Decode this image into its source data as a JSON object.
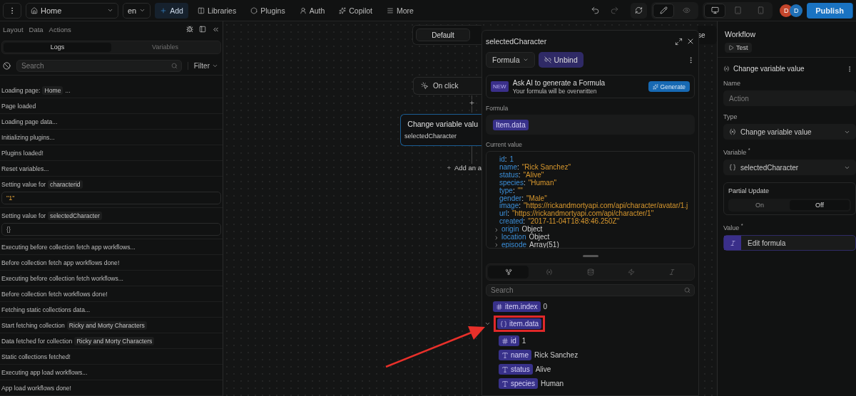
{
  "topbar": {
    "page": "Home",
    "lang": "en",
    "nav": [
      {
        "kind": "add",
        "label": "Add"
      },
      {
        "kind": "libraries",
        "label": "Libraries"
      },
      {
        "kind": "plugins",
        "label": "Plugins"
      },
      {
        "kind": "auth",
        "label": "Auth"
      },
      {
        "kind": "copilot",
        "label": "Copilot"
      },
      {
        "kind": "more",
        "label": "More"
      }
    ],
    "modes": [
      {
        "kind": "edit",
        "selected": true
      },
      {
        "kind": "preview",
        "selected": false
      }
    ],
    "devices": [
      {
        "kind": "desktop",
        "selected": true
      },
      {
        "kind": "tablet",
        "selected": false
      },
      {
        "kind": "mobile",
        "selected": false
      }
    ],
    "avatars": [
      {
        "letter": "D",
        "color": "#c4452b"
      },
      {
        "letter": "D",
        "color": "#1f6fb5"
      }
    ],
    "publish": "Publish"
  },
  "left_panel": {
    "tabs": [
      "Layout",
      "Data",
      "Actions"
    ],
    "segments": [
      {
        "label": "Logs",
        "selected": true
      },
      {
        "label": "Variables",
        "selected": false
      }
    ],
    "search": {
      "placeholder": "Search"
    },
    "filter": "Filter",
    "logs": [
      {
        "text": "Loading page:",
        "tag": "Home",
        "after": "..."
      },
      {
        "text": "Page loaded"
      },
      {
        "text": "Loading page data..."
      },
      {
        "text": "Initializing plugins..."
      },
      {
        "text": "Plugins loaded!"
      },
      {
        "text": "Reset variables..."
      },
      {
        "text": "Setting value for",
        "tag": "characterid",
        "value": "\"1\"",
        "kind": "string"
      },
      {
        "text": "Setting value for",
        "tag": "selectedCharacter",
        "value": "{}",
        "kind": "object"
      },
      {
        "text": "Executing before collection fetch app workflows..."
      },
      {
        "text": "Before collection fetch app workflows done!"
      },
      {
        "text": "Executing before collection fetch workflows..."
      },
      {
        "text": "Before collection fetch workflows done!"
      },
      {
        "text": "Fetching static collections data..."
      },
      {
        "text": "Start fetching collection",
        "tag": "Ricky and Morty Characters"
      },
      {
        "text": "Data fetched for collection",
        "tag": "Ricky and Morty Characters"
      },
      {
        "text": "Static collections fetched!"
      },
      {
        "text": "Executing app load workflows..."
      },
      {
        "text": "App load workflows done!"
      }
    ]
  },
  "canvas": {
    "state_tab": "Default",
    "corner_button": "se",
    "trigger": "On click",
    "action": {
      "title": "Change variable valu",
      "subtitle": "selectedCharacter"
    },
    "add_action": "Add an a"
  },
  "formula_popup": {
    "title": "selectedCharacter",
    "mode": "Formula",
    "unbind": "Unbind",
    "ai": {
      "badge": "NEW",
      "title": "Ask AI to generate a Formula",
      "subtitle": "Your formula will be overwritten",
      "button": "Generate"
    },
    "formula_label": "Formula",
    "formula": "Item.data",
    "current_label": "Current value",
    "current_value": [
      {
        "key": "id",
        "sep": ":",
        "value": "1",
        "kind": "number"
      },
      {
        "key": "name",
        "sep": ":",
        "value": "\"Rick Sanchez\"",
        "kind": "string"
      },
      {
        "key": "status",
        "sep": ":",
        "value": "\"Alive\"",
        "kind": "string"
      },
      {
        "key": "species",
        "sep": ":",
        "value": "\"Human\"",
        "kind": "string"
      },
      {
        "key": "type",
        "sep": ":",
        "value": "\"\"",
        "kind": "string"
      },
      {
        "key": "gender",
        "sep": ":",
        "value": "\"Male\"",
        "kind": "string"
      },
      {
        "key": "image",
        "sep": ":",
        "value": "\"https://rickandmortyapi.com/api/character/avatar/1.j",
        "kind": "string"
      },
      {
        "key": "url",
        "sep": ":",
        "value": "\"https://rickandmortyapi.com/api/character/1\"",
        "kind": "string"
      },
      {
        "key": "created",
        "sep": ":",
        "value": "\"2017-11-04T18:48:46.250Z\"",
        "kind": "string"
      },
      {
        "key": "origin",
        "value": "Object",
        "kind": "object"
      },
      {
        "key": "location",
        "value": "Object",
        "kind": "object"
      },
      {
        "key": "episode",
        "value": "Array(51)",
        "kind": "object"
      }
    ],
    "source_tabs": [
      {
        "kind": "tree",
        "selected": true
      },
      {
        "kind": "variables",
        "selected": false
      },
      {
        "kind": "data",
        "selected": false
      },
      {
        "kind": "actions",
        "selected": false
      },
      {
        "kind": "functions",
        "selected": false
      }
    ],
    "search": {
      "placeholder": "Search"
    },
    "tree": [
      {
        "kind": "number",
        "name": "item.index",
        "value": "0"
      },
      {
        "kind": "object",
        "name": "item.data",
        "expanded": true,
        "highlighted": true,
        "children": [
          {
            "kind": "number",
            "name": "id",
            "value": "1"
          },
          {
            "kind": "text",
            "name": "name",
            "value": "Rick Sanchez"
          },
          {
            "kind": "text",
            "name": "status",
            "value": "Alive"
          },
          {
            "kind": "text",
            "name": "species",
            "value": "Human"
          }
        ]
      }
    ]
  },
  "workflow_panel": {
    "title": "Workflow",
    "test": "Test",
    "action_title": "Change variable value",
    "fields": [
      {
        "kind": "input",
        "label": "Name",
        "placeholder": "Action"
      },
      {
        "kind": "type-select",
        "label": "Type",
        "value": "Change variable value"
      },
      {
        "kind": "variable-select",
        "label": "Variable $^{*}$",
        "value": "selectedCharacter"
      }
    ],
    "partial_update": {
      "label": "Partial Update",
      "options": [
        {
          "label": "On",
          "selected": false
        },
        {
          "label": "Off",
          "selected": true
        }
      ]
    },
    "value_field": {
      "label": "Value $^{*}$",
      "button": "Edit formula"
    }
  }
}
